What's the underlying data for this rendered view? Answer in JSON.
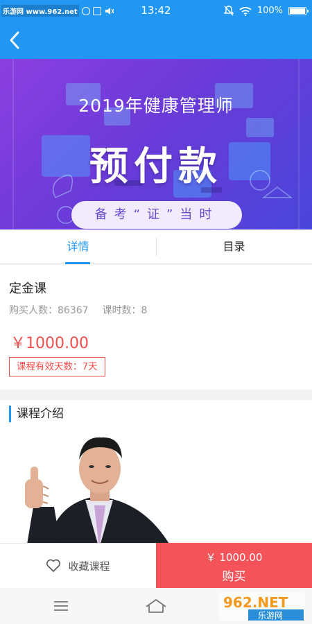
{
  "status_bar": {
    "site": "乐游网 www.962.net",
    "time": "13:42",
    "battery": "100%"
  },
  "nav": {
    "back_icon": "chevron-left-icon"
  },
  "banner": {
    "line1": "2019年健康管理师",
    "line2": "预付款",
    "slogan": "备考“证”当时"
  },
  "tabs": [
    {
      "label": "详情",
      "active": true
    },
    {
      "label": "目录",
      "active": false
    }
  ],
  "course": {
    "title": "定金课",
    "buyers": "购买人数：86367",
    "lessons": "课时数：8",
    "price": "￥1000.00",
    "valid_days": "课程有效天数：7天"
  },
  "intro": {
    "title": "课程介绍"
  },
  "bottom_bar": {
    "favorite_label": "收藏课程",
    "favorite_icon": "heart-icon",
    "buy_price": "￥ 1000.00",
    "buy_label": "购买"
  },
  "watermark": {
    "brand": "962.NET",
    "sub": "乐游网"
  },
  "colors": {
    "primary": "#2196f3",
    "price_red": "#f24d4d",
    "buy_bg": "#f5535a"
  }
}
